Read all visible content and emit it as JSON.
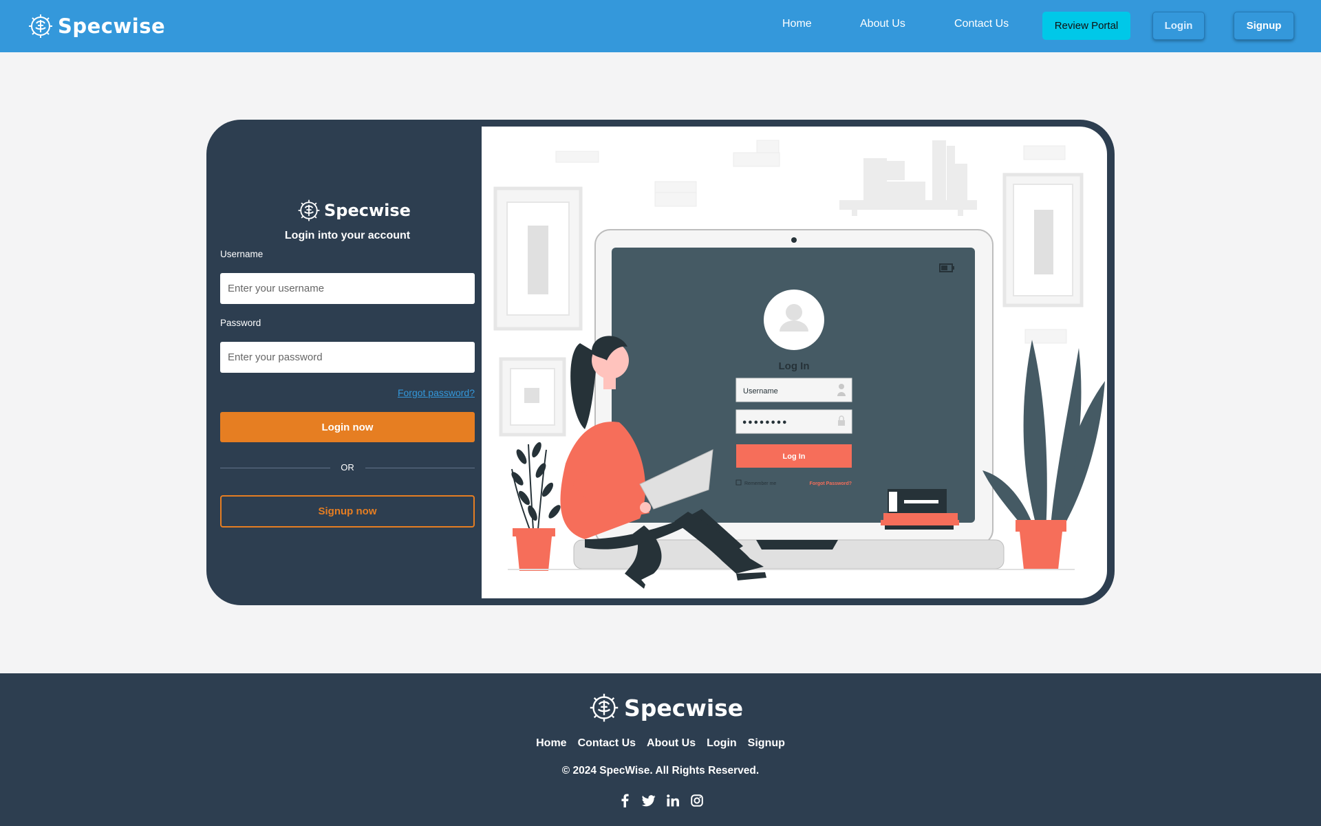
{
  "brand": {
    "name": "Specwise",
    "logo_icon": "gear-brain-icon"
  },
  "nav": {
    "links": [
      "Home",
      "About Us",
      "Contact Us"
    ],
    "review_portal": "Review Portal",
    "login": "Login",
    "signup": "Signup"
  },
  "form": {
    "heading": "Login into your account",
    "username_label": "Username",
    "username_placeholder": "Enter your username",
    "password_label": "Password",
    "password_placeholder": "Enter your password",
    "forgot": "Forgot password?",
    "login_button": "Login now",
    "or": "OR",
    "signup_button": "Signup now"
  },
  "illustration": {
    "title": "Log In",
    "username": "Username",
    "password_mask": "••••••••",
    "button": "Log In",
    "remember": "Remember me",
    "forgot": "Forgot Password?"
  },
  "footer": {
    "links": [
      "Home",
      "Contact Us",
      "About Us",
      "Login",
      "Signup"
    ],
    "copyright": "© 2024 SpecWise. All Rights Reserved.",
    "socials": [
      "facebook-icon",
      "twitter-icon",
      "linkedin-icon",
      "instagram-icon"
    ]
  },
  "colors": {
    "navbar": "#3498db",
    "dark": "#2d3e50",
    "accent_orange": "#e67e22",
    "review_cyan": "#00c8e8",
    "illustration_coral": "#f66e5a"
  }
}
